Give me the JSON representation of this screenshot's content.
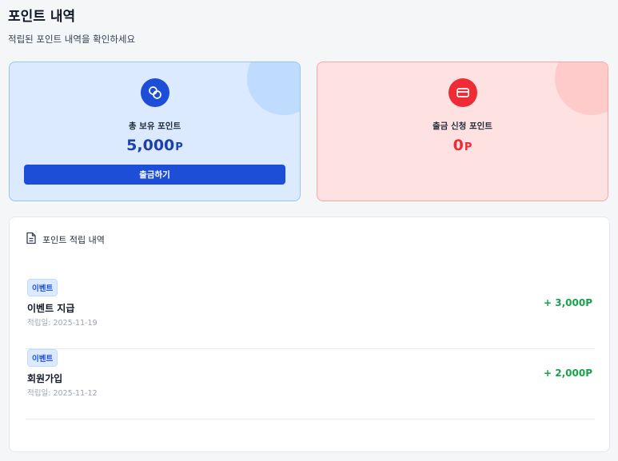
{
  "header": {
    "title": "포인트 내역",
    "subtitle": "적립된 포인트 내역을 확인하세요"
  },
  "summary": {
    "total": {
      "label": "총 보유 포인트",
      "amount": "5,000",
      "unit": "P",
      "button_label": "출금하기",
      "icon": "coins-icon",
      "accent": "#1d4ed8"
    },
    "withdraw": {
      "label": "출금 신청 포인트",
      "amount": "0",
      "unit": "P",
      "icon": "credit-card-icon",
      "accent": "#ef2b35"
    }
  },
  "history": {
    "title": "포인트 적립 내역",
    "icon": "document-icon",
    "items": [
      {
        "badge": "이벤트",
        "title": "이벤트 지급",
        "date": "적립일: 2025-11-19",
        "amount": "+ 3,000P"
      },
      {
        "badge": "이벤트",
        "title": "회원가입",
        "date": "적립일: 2025-11-12",
        "amount": "+ 2,000P"
      }
    ]
  }
}
